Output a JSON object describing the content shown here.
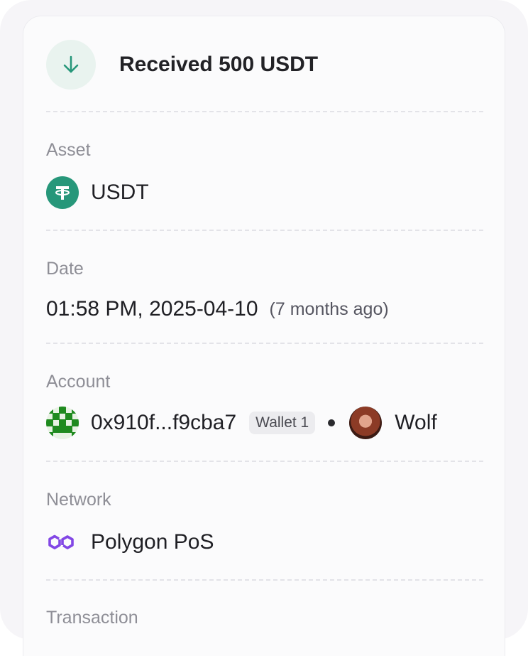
{
  "header": {
    "title": "Received 500 USDT",
    "icon": "arrow-down-icon",
    "accent": "#27977a"
  },
  "asset": {
    "label": "Asset",
    "name": "USDT",
    "icon": "tether-icon"
  },
  "date": {
    "label": "Date",
    "value": "01:58 PM, 2025-04-10",
    "relative": "(7 months ago)"
  },
  "account": {
    "label": "Account",
    "address": "0x910f...f9cba7",
    "wallet_badge": "Wallet 1",
    "contact_name": "Wolf",
    "icons": [
      "identicon-avatar",
      "contact-avatar"
    ]
  },
  "network": {
    "label": "Network",
    "name": "Polygon PoS",
    "icon": "polygon-icon",
    "brand_color": "#8247e5"
  },
  "transaction": {
    "label": "Transaction"
  }
}
